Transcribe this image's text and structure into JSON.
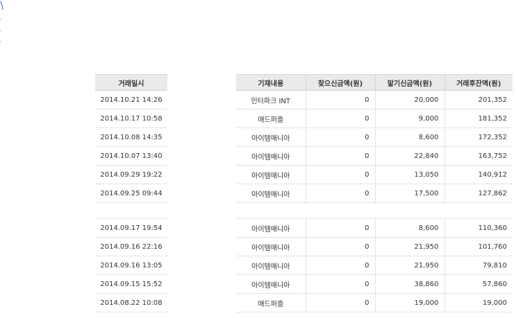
{
  "columns": {
    "date": "거래일시",
    "description": "기재내용",
    "withdrawal": "찾으신금액(원)",
    "deposit": "맡기신금액(원)",
    "balance": "거래후잔액(원)"
  },
  "rows_top": [
    {
      "date": "2014.10.21 14:26",
      "description": "인터파크 INT",
      "withdrawal": "0",
      "deposit": "20,000",
      "balance": "201,352"
    },
    {
      "date": "2014.10.17 10:58",
      "description": "애드퍼즐",
      "withdrawal": "0",
      "deposit": "9,000",
      "balance": "181,352"
    },
    {
      "date": "2014.10.08 14:35",
      "description": "아이템매니아",
      "withdrawal": "0",
      "deposit": "8,600",
      "balance": "172,352"
    },
    {
      "date": "2014.10.07 13:40",
      "description": "아이템매니아",
      "withdrawal": "0",
      "deposit": "22,840",
      "balance": "163,752"
    },
    {
      "date": "2014.09.29 19:22",
      "description": "아이템매니아",
      "withdrawal": "0",
      "deposit": "13,050",
      "balance": "140,912"
    },
    {
      "date": "2014.09.25 09:44",
      "description": "아이템매니아",
      "withdrawal": "0",
      "deposit": "17,500",
      "balance": "127,862"
    }
  ],
  "rows_bottom": [
    {
      "date": "2014.09.17 19:54",
      "description": "아이템매니아",
      "withdrawal": "0",
      "deposit": "8,600",
      "balance": "110,360"
    },
    {
      "date": "2014.09.16 22:16",
      "description": "아이템매니아",
      "withdrawal": "0",
      "deposit": "21,950",
      "balance": "101,760"
    },
    {
      "date": "2014.09.16 13:05",
      "description": "아이템매니아",
      "withdrawal": "0",
      "deposit": "21,950",
      "balance": "79,810"
    },
    {
      "date": "2014.09.15 15:52",
      "description": "아이템매니아",
      "withdrawal": "0",
      "deposit": "38,860",
      "balance": "57,860"
    },
    {
      "date": "2014.08.22 10:08",
      "description": "애드퍼즐",
      "withdrawal": "0",
      "deposit": "19,000",
      "balance": "19,000"
    }
  ]
}
